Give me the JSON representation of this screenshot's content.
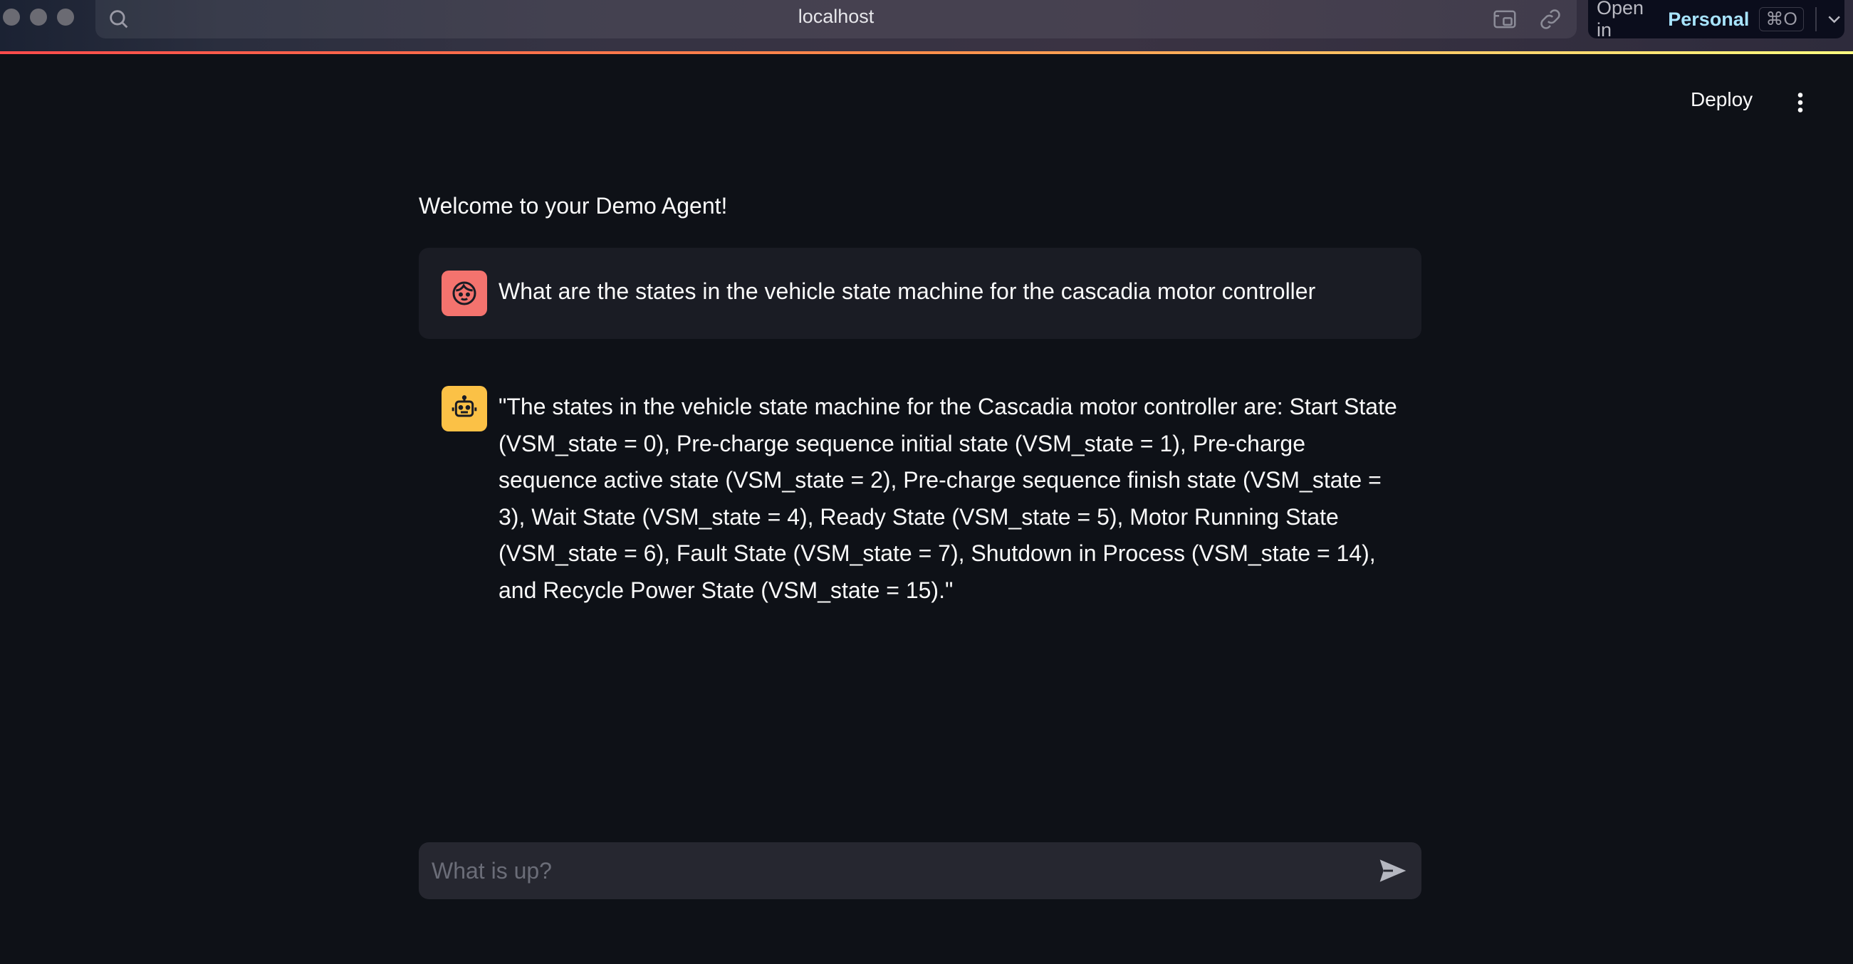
{
  "browser": {
    "address": "localhost",
    "open_in": {
      "prefix": "Open in",
      "target": "Personal",
      "shortcut": "⌘O"
    }
  },
  "header": {
    "deploy_label": "Deploy",
    "menu_icon": "kebab-menu-icon"
  },
  "main": {
    "welcome": "Welcome to your Demo Agent!",
    "messages": [
      {
        "role": "user",
        "avatar_icon": "face-icon",
        "avatar_color": "#f4736e",
        "text": "What are the states in the vehicle state machine for the cascadia motor controller"
      },
      {
        "role": "assistant",
        "avatar_icon": "robot-icon",
        "avatar_color": "#fbc146",
        "text": "\"The states in the vehicle state machine for the Cascadia motor controller are: Start State (VSM_state = 0), Pre-charge sequence initial state (VSM_state = 1), Pre-charge sequence active state (VSM_state = 2), Pre-charge sequence finish state (VSM_state = 3), Wait State (VSM_state = 4), Ready State (VSM_state = 5), Motor Running State (VSM_state = 6), Fault State (VSM_state = 7), Shutdown in Process (VSM_state = 14), and Recycle Power State (VSM_state = 15).\""
      }
    ]
  },
  "chat_input": {
    "placeholder": "What is up?",
    "value": "",
    "send_icon": "send-icon"
  },
  "colors": {
    "background": "#0e1117",
    "user_bubble": "#1a1c24",
    "input_background": "#262730",
    "user_avatar": "#f4736e",
    "bot_avatar": "#fbc146"
  }
}
